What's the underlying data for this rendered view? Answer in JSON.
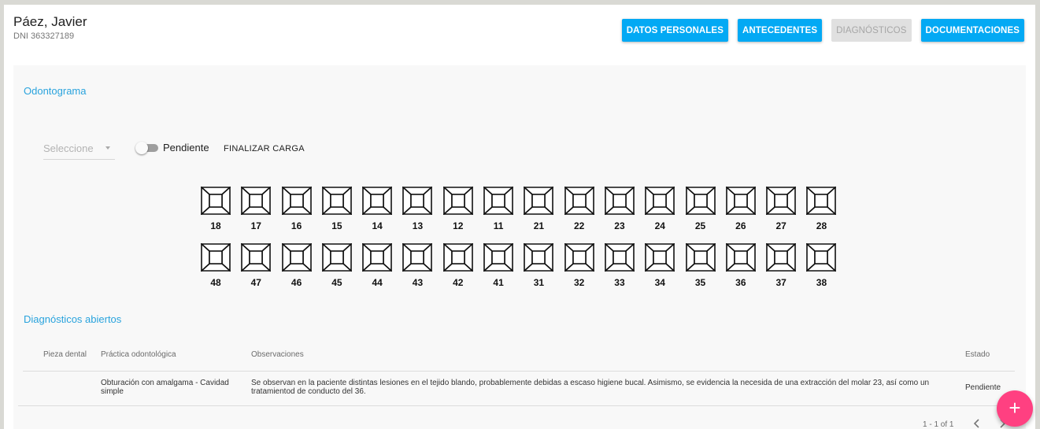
{
  "header": {
    "patient_name": "Páez, Javier",
    "patient_dni": "DNI 363327189"
  },
  "tabs": [
    {
      "label": "DATOS PERSONALES",
      "enabled": true
    },
    {
      "label": "ANTECEDENTES",
      "enabled": true
    },
    {
      "label": "DIAGNÓSTICOS",
      "enabled": false
    },
    {
      "label": "DOCUMENTACIONES",
      "enabled": true
    }
  ],
  "odontograma": {
    "title": "Odontograma",
    "select_placeholder": "Seleccione",
    "toggle_label": "Pendiente",
    "toggle_on": false,
    "finalize_label": "FINALIZAR CARGA",
    "upper_teeth": [
      "18",
      "17",
      "16",
      "15",
      "14",
      "13",
      "12",
      "11",
      "21",
      "22",
      "23",
      "24",
      "25",
      "26",
      "27",
      "28"
    ],
    "lower_teeth": [
      "48",
      "47",
      "46",
      "45",
      "44",
      "43",
      "42",
      "41",
      "31",
      "32",
      "33",
      "34",
      "35",
      "36",
      "37",
      "38"
    ]
  },
  "diagnosticos": {
    "title": "Diagnósticos abiertos",
    "columns": [
      "Pieza dental",
      "Práctica odontológica",
      "Observaciones",
      "Estado"
    ],
    "rows": [
      {
        "pieza": "",
        "practica": "Obturación con amalgama - Cavidad simple",
        "observaciones": "Se observan en la paciente distintas lesiones en el tejido blando, probablemente debidas a escaso higiene bucal. Asimismo, se evidencia la necesida de una extracción del molar 23, así como un tratamientod de conducto del 36.",
        "estado": "Pendiente"
      }
    ],
    "pagination": "1 - 1 of 1"
  },
  "colors": {
    "primary": "#03a9f4",
    "accent": "#ff4081",
    "section_title": "#29a3dd"
  }
}
